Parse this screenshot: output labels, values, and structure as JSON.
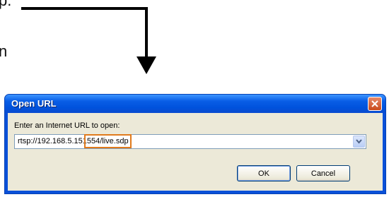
{
  "document": {
    "line1": "p.",
    "line2": "n"
  },
  "dialog": {
    "title": "Open URL",
    "prompt": "Enter an Internet URL to open:",
    "url_prefix": "rtsp://192.168.5.151",
    "url_highlight": "554/live.sdp",
    "ok_label": "OK",
    "cancel_label": "Cancel"
  },
  "colors": {
    "highlight": "#e07a1c",
    "titlebar": "#0a5ee6",
    "close_button": "#d55a30"
  },
  "icons": {
    "close": "close-icon",
    "dropdown": "chevron-down-icon",
    "arrow": "arrow-down-icon"
  }
}
